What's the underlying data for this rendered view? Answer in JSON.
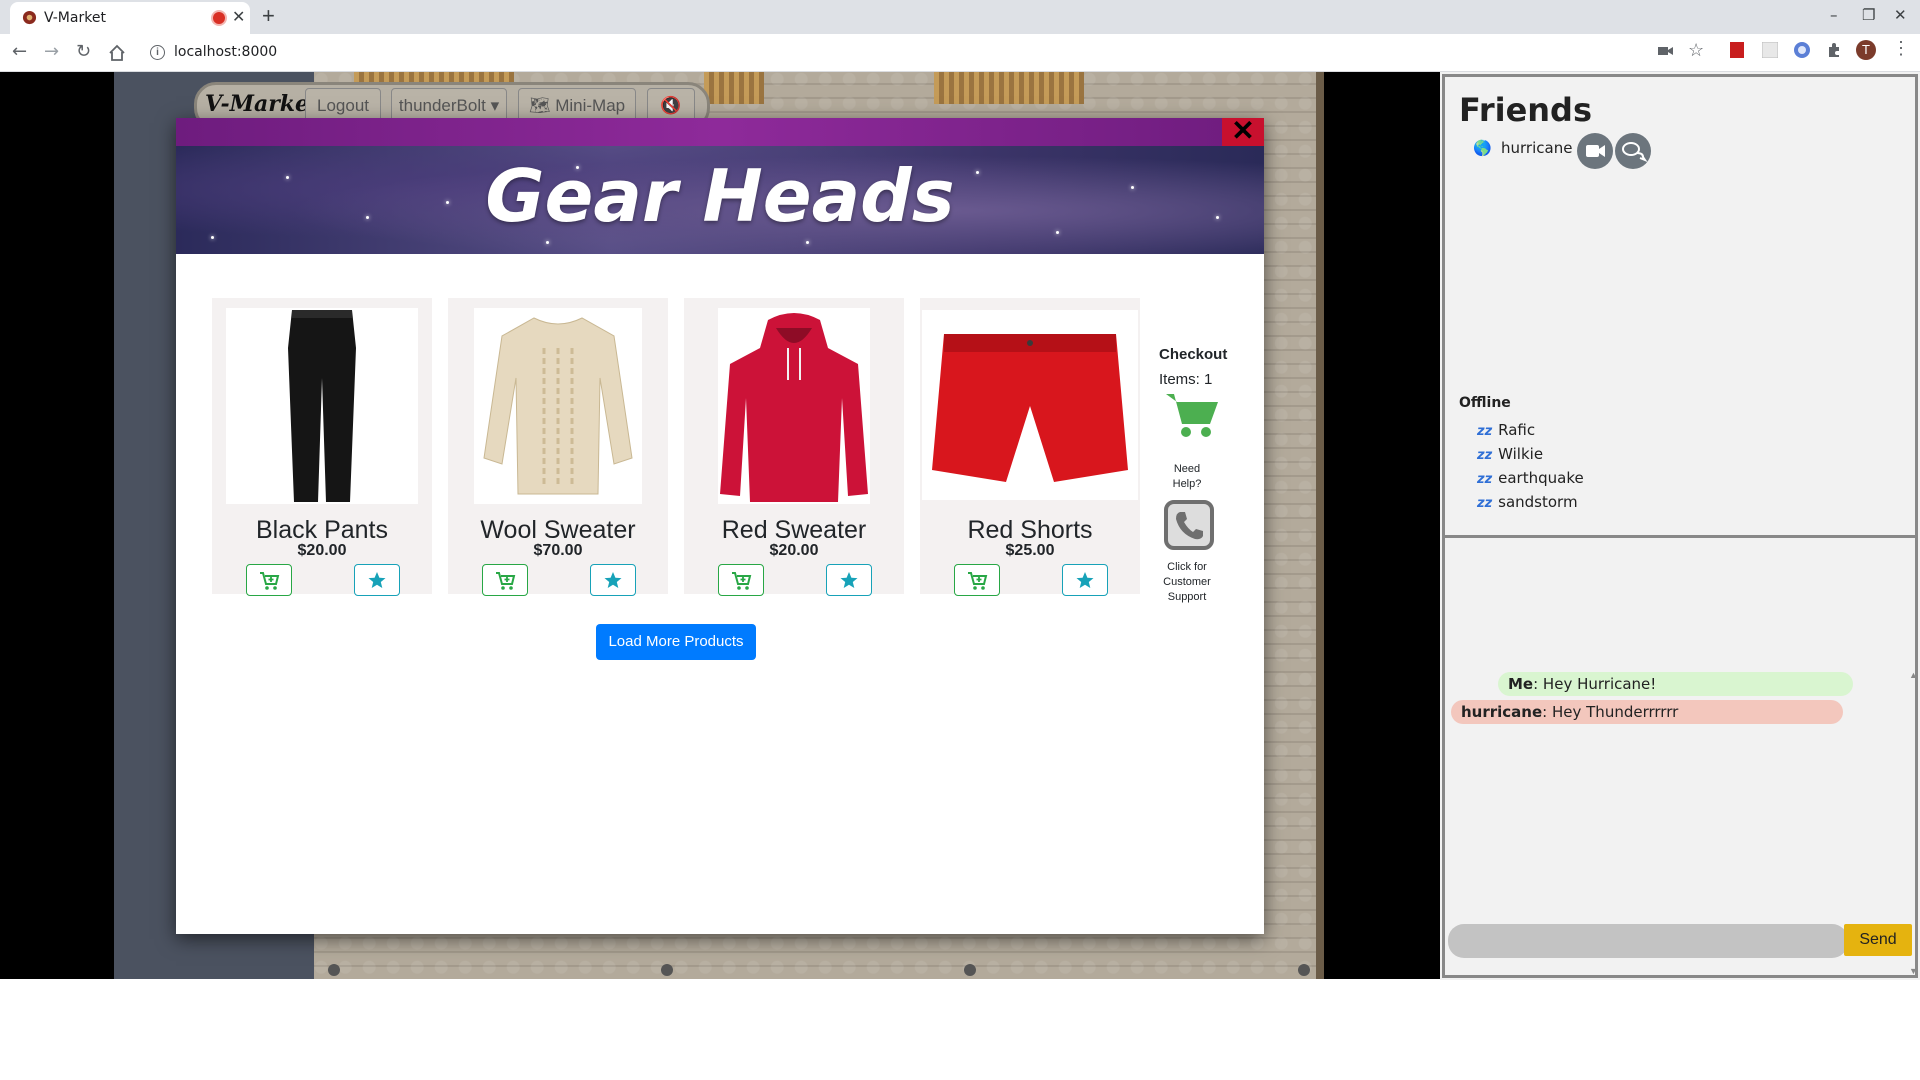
{
  "browser": {
    "tab_title": "V-Market",
    "url": "localhost:8000",
    "profile_initial": "T",
    "window_controls": [
      "–",
      "❐",
      "✕"
    ]
  },
  "game_nav": {
    "logo": "V-Market",
    "logout": "Logout",
    "username": "thunderBolt",
    "minimap": "Mini-Map"
  },
  "shop": {
    "title": "Gear Heads",
    "close_symbol": "✕",
    "products": [
      {
        "name": "Black Pants",
        "price": "$20.00"
      },
      {
        "name": "Wool Sweater",
        "price": "$70.00"
      },
      {
        "name": "Red Sweater",
        "price": "$20.00"
      },
      {
        "name": "Red Shorts",
        "price": "$25.00"
      }
    ],
    "checkout_label": "Checkout",
    "items_label": "Items: 1",
    "help_line1": "Need",
    "help_line2": "Help?",
    "support_line1": "Click for",
    "support_line2": "Customer",
    "support_line3": "Support",
    "load_more": "Load More Products"
  },
  "friends": {
    "title": "Friends",
    "online": [
      {
        "name": "hurricane"
      }
    ],
    "offline_title": "Offline",
    "offline": [
      "Rafic",
      "Wilkie",
      "earthquake",
      "sandstorm"
    ],
    "messages": [
      {
        "sender": "Me",
        "text": ": Hey Hurricane!"
      },
      {
        "sender": "hurricane",
        "text": ": Hey Thunderrrrrr"
      }
    ],
    "send": "Send"
  },
  "colors": {
    "accent_blue": "#007bff",
    "cart_green": "#28a745",
    "star_teal": "#17a2b8",
    "modal_purple": "#8e2a9a",
    "close_red": "#c8102e",
    "send_yellow": "#e5b30f",
    "msg_me_bg": "#d9f5d0",
    "msg_friend_bg": "#f3c7bd"
  }
}
